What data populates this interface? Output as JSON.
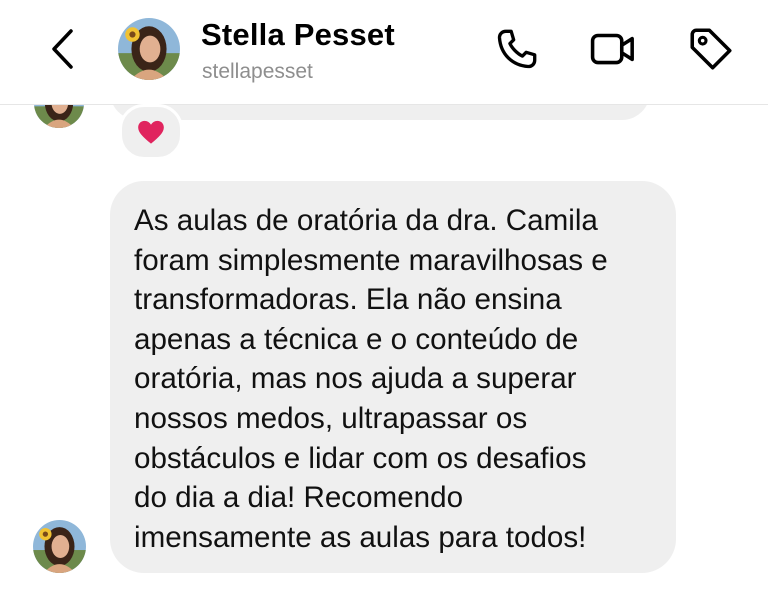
{
  "header": {
    "name": "Stella Pesset",
    "handle": "stellapesset",
    "icons": [
      "back-chevron-icon",
      "phone-icon",
      "video-icon",
      "tag-icon"
    ]
  },
  "thread": {
    "reaction": "❤️",
    "message": "As aulas de oratória da dra. Camila\nforam simplesmente maravilhosas e\ntransformadoras. Ela não ensina\napenas a técnica e o conteúdo de\noratória, mas nos ajuda a superar\nnossos medos, ultrapassar os\nobstáculos e lidar com os desafios\ndo dia a dia! Recomendo\nimensamente as aulas para todos!"
  },
  "colors": {
    "bubble": "#efefef",
    "secondary_text": "#8e8e8e",
    "heart": "#e0245e"
  }
}
